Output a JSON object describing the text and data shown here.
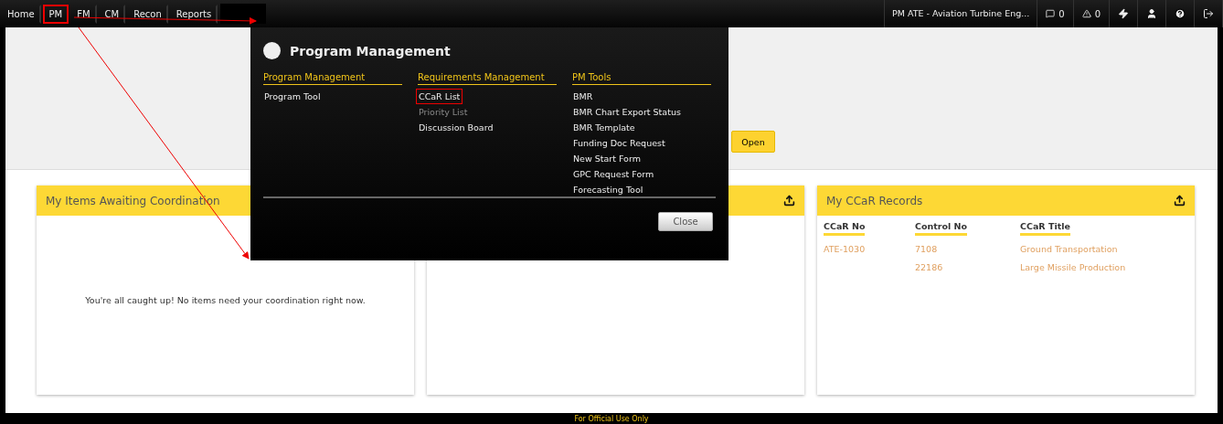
{
  "nav": {
    "items": [
      {
        "label": "Home",
        "highlighted": false
      },
      {
        "label": "PM",
        "highlighted": true
      },
      {
        "label": "FM",
        "highlighted": false
      },
      {
        "label": "CM",
        "highlighted": false
      },
      {
        "label": "Recon",
        "highlighted": false
      },
      {
        "label": "Reports",
        "highlighted": false
      }
    ],
    "org": "PM ATE - Aviation Turbine Eng...",
    "indicators": [
      {
        "kind": "messages",
        "count": "0"
      },
      {
        "kind": "alerts",
        "count": "0"
      }
    ],
    "actions": [
      {
        "kind": "bolt"
      },
      {
        "kind": "user"
      },
      {
        "kind": "help"
      },
      {
        "kind": "logout"
      }
    ]
  },
  "banner": {
    "button": "Open"
  },
  "menu": {
    "title": "Program Management",
    "close": "Close",
    "columns": [
      {
        "heading": "Program Management",
        "items": [
          {
            "label": "Program Tool",
            "disabled": false,
            "highlighted": false
          }
        ]
      },
      {
        "heading": "Requirements Management",
        "items": [
          {
            "label": "CCaR List",
            "disabled": false,
            "highlighted": true
          },
          {
            "label": "Priority List",
            "disabled": true,
            "highlighted": false
          },
          {
            "label": "Discussion Board",
            "disabled": false,
            "highlighted": false
          }
        ]
      },
      {
        "heading": "PM Tools",
        "items": [
          {
            "label": "BMR",
            "disabled": false,
            "highlighted": false
          },
          {
            "label": "BMR Chart Export Status",
            "disabled": false,
            "highlighted": false
          },
          {
            "label": "BMR Template",
            "disabled": false,
            "highlighted": false
          },
          {
            "label": "Funding Doc Request",
            "disabled": false,
            "highlighted": false
          },
          {
            "label": "New Start Form",
            "disabled": false,
            "highlighted": false
          },
          {
            "label": "GPC Request Form",
            "disabled": false,
            "highlighted": false
          },
          {
            "label": "Forecasting Tool",
            "disabled": false,
            "highlighted": false
          }
        ]
      }
    ]
  },
  "cards": [
    {
      "kind": "message",
      "title": "My Items Awaiting Coordination",
      "message": "You're all caught up! No items need your coordination right now."
    },
    {
      "kind": "blank",
      "export": true
    },
    {
      "kind": "table",
      "title": "My CCaR Records",
      "export": true,
      "columns": [
        "CCaR No",
        "Control No",
        "CCaR Title"
      ],
      "rows": [
        {
          "ccar_no": "ATE-1030",
          "control_no": "7108",
          "ccar_title": "Ground Transportation"
        },
        {
          "control_no": "22186",
          "ccar_title": "Large Missile Production"
        }
      ]
    }
  ],
  "footer": "For Official Use Only"
}
